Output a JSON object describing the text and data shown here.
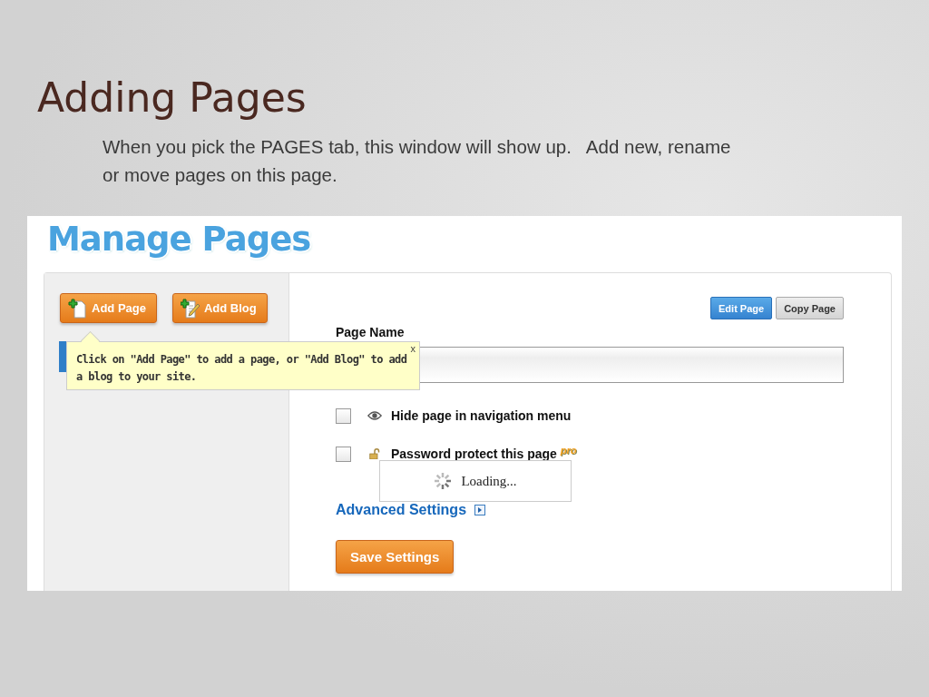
{
  "slide": {
    "title": "Adding Pages",
    "text": "When you pick the PAGES tab, this window will show up.   Add new, rename or move pages on this page."
  },
  "app": {
    "heading": "Manage Pages",
    "sidebar_buttons": [
      {
        "label": "Add Page",
        "kind": "page"
      },
      {
        "label": "Add Blog",
        "kind": "blog"
      }
    ],
    "tooltip": {
      "text": "Click on \"Add Page\" to add a page, or \"Add Blog\" to add a blog to your site.",
      "close": "x"
    },
    "toolbar": [
      {
        "label": "Edit Page",
        "selected": true
      },
      {
        "label": "Copy Page",
        "selected": false
      }
    ],
    "page_name_label": "Page Name",
    "options": [
      {
        "label": "Hide page in navigation menu",
        "checked": false,
        "kind": "eye"
      },
      {
        "label": "Password protect this page",
        "checked": false,
        "kind": "lock",
        "badge": "pro"
      }
    ],
    "loading": "Loading...",
    "advanced": "Advanced Settings",
    "save": "Save Settings"
  }
}
